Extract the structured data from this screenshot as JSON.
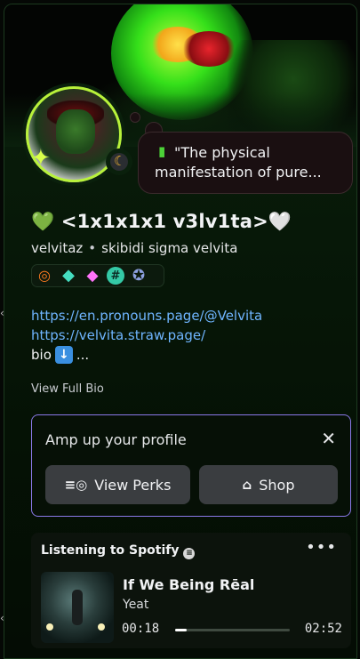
{
  "custom_status": {
    "emoji": "custom-emoji-icon",
    "text": "\"The physical manifestation of pure..."
  },
  "profile": {
    "display_name_heart_left": "💚",
    "display_name": " <1x1x1x1 v3lv1ta>",
    "display_name_heart_right": "🤍",
    "username": "velvitaz",
    "separator": "•",
    "pronouns": "skibidi sigma velvita",
    "badges": [
      {
        "name": "nitro-badge-icon"
      },
      {
        "name": "hypesquad-badge-icon"
      },
      {
        "name": "server-boost-badge-icon"
      },
      {
        "name": "hashtag-badge-icon"
      },
      {
        "name": "quest-badge-icon"
      }
    ]
  },
  "bio": {
    "link1": "https://en.pronouns.page/@Velvita",
    "link2": "https://velvita.straw.page/",
    "line3_text": "bio",
    "line3_suffix": "...",
    "view_full_bio": "View Full Bio"
  },
  "amp_card": {
    "title": "Amp up your profile",
    "perks_label": "View Perks",
    "shop_label": "Shop"
  },
  "spotify": {
    "header": "Listening to Spotify",
    "song": "If We Being Rēal",
    "artist": "Yeat",
    "elapsed": "00:18",
    "duration": "02:52",
    "progress": 0.104
  },
  "colors": {
    "accent_border": "#8a79e8",
    "link": "#6fb5ff",
    "status_idle": "#f0b232"
  }
}
